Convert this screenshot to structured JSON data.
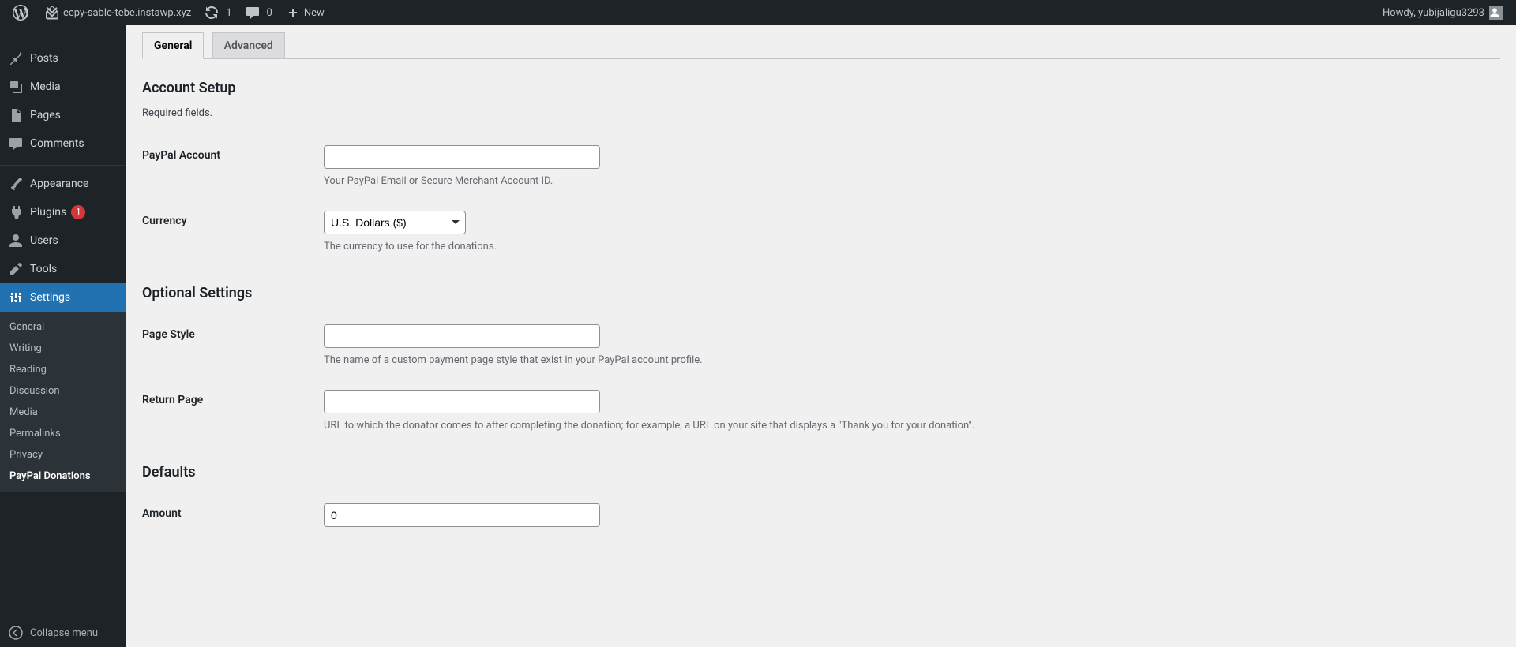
{
  "adminbar": {
    "site_name": "eepy-sable-tebe.instawp.xyz",
    "updates": "1",
    "comments": "0",
    "new": "New",
    "howdy": "Howdy, yubijaligu3293"
  },
  "sidebar": {
    "posts": "Posts",
    "media": "Media",
    "pages": "Pages",
    "comments": "Comments",
    "appearance": "Appearance",
    "plugins": "Plugins",
    "plugins_badge": "1",
    "users": "Users",
    "tools": "Tools",
    "settings": "Settings",
    "collapse": "Collapse menu"
  },
  "submenu": {
    "general": "General",
    "writing": "Writing",
    "reading": "Reading",
    "discussion": "Discussion",
    "media": "Media",
    "permalinks": "Permalinks",
    "privacy": "Privacy",
    "paypal": "PayPal Donations"
  },
  "tabs": {
    "general": "General",
    "advanced": "Advanced"
  },
  "sections": {
    "account_setup": "Account Setup",
    "required": "Required fields.",
    "optional": "Optional Settings",
    "defaults": "Defaults"
  },
  "fields": {
    "paypal_account": {
      "label": "PayPal Account",
      "value": "",
      "desc": "Your PayPal Email or Secure Merchant Account ID."
    },
    "currency": {
      "label": "Currency",
      "value": "U.S. Dollars ($)",
      "desc": "The currency to use for the donations."
    },
    "page_style": {
      "label": "Page Style",
      "value": "",
      "desc": "The name of a custom payment page style that exist in your PayPal account profile."
    },
    "return_page": {
      "label": "Return Page",
      "value": "",
      "desc": "URL to which the donator comes to after completing the donation; for example, a URL on your site that displays a \"Thank you for your donation\"."
    },
    "amount": {
      "label": "Amount",
      "value": "0"
    }
  }
}
